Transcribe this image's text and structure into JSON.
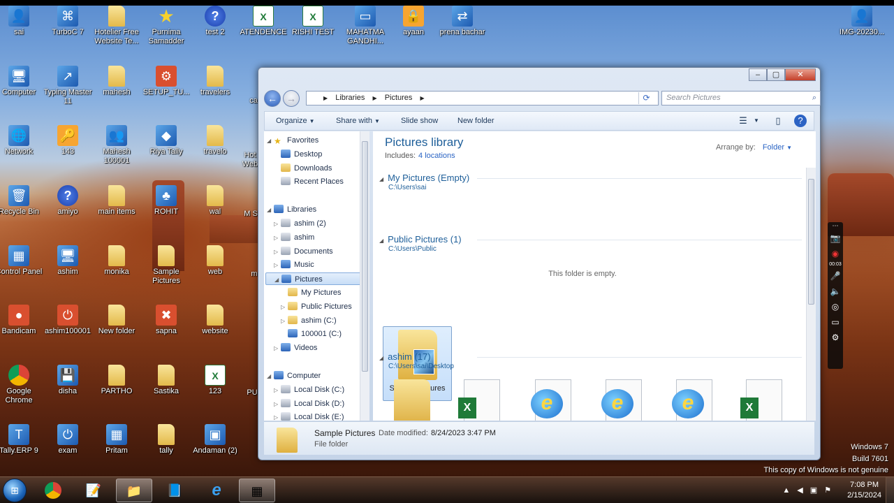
{
  "desktop_icons": [
    {
      "label": "sai",
      "icon": "user-folder-icon",
      "glyph": "👤",
      "kind": "app"
    },
    {
      "label": "TurboC 7",
      "icon": "turboc-icon",
      "glyph": "⌘",
      "kind": "app"
    },
    {
      "label": "Hotelier Free Website Te...",
      "icon": "folder-icon",
      "glyph": "",
      "kind": "folder"
    },
    {
      "label": "Purnima Samadder",
      "icon": "star-icon",
      "glyph": "★",
      "kind": "star"
    },
    {
      "label": "test 2",
      "icon": "help-icon",
      "glyph": "?",
      "kind": "help"
    },
    {
      "label": "ATENDENCE",
      "icon": "excel-icon",
      "glyph": "X",
      "kind": "excel"
    },
    {
      "label": "RISHI TEST",
      "icon": "excel-icon",
      "glyph": "X",
      "kind": "excel"
    },
    {
      "label": "MAHATMA GANDHI...",
      "icon": "drive-icon",
      "glyph": "▭",
      "kind": "app"
    },
    {
      "label": "ayaan",
      "icon": "lock-icon",
      "glyph": "🔒",
      "kind": "orange"
    },
    {
      "label": "prena bachar",
      "icon": "network-icon",
      "glyph": "⇄",
      "kind": "app"
    },
    {
      "label": "Computer",
      "icon": "computer-icon",
      "glyph": "🖥",
      "kind": "app"
    },
    {
      "label": "Typing Master 11",
      "icon": "typing-master-icon",
      "glyph": "↗",
      "kind": "app"
    },
    {
      "label": "mahesh",
      "icon": "folder-icon",
      "glyph": "",
      "kind": "folder"
    },
    {
      "label": "SETUP_TU...",
      "icon": "setup-icon",
      "glyph": "⚙",
      "kind": "red"
    },
    {
      "label": "travelers",
      "icon": "folder-icon",
      "glyph": "",
      "kind": "folder"
    },
    {
      "label": "Network",
      "icon": "network-globe-icon",
      "glyph": "🌐",
      "kind": "app"
    },
    {
      "label": "143",
      "icon": "key-icon",
      "glyph": "🔑",
      "kind": "orange"
    },
    {
      "label": "Mahesh 100001",
      "icon": "people-icon",
      "glyph": "👥",
      "kind": "app"
    },
    {
      "label": "Riya Tally",
      "icon": "tally-icon",
      "glyph": "◆",
      "kind": "app"
    },
    {
      "label": "travelo",
      "icon": "folder-icon",
      "glyph": "",
      "kind": "folder"
    },
    {
      "label": "Recycle Bin",
      "icon": "recycle-bin-icon",
      "glyph": "🗑",
      "kind": "app"
    },
    {
      "label": "amiyo",
      "icon": "help-icon",
      "glyph": "?",
      "kind": "help"
    },
    {
      "label": "main items",
      "icon": "folder-icon",
      "glyph": "",
      "kind": "folder"
    },
    {
      "label": "ROHIT",
      "icon": "tree-icon",
      "glyph": "♣",
      "kind": "app"
    },
    {
      "label": "wal",
      "icon": "folder-icon",
      "glyph": "",
      "kind": "folder"
    },
    {
      "label": "Control Panel",
      "icon": "control-panel-icon",
      "glyph": "▦",
      "kind": "app"
    },
    {
      "label": "ashim",
      "icon": "computer-icon",
      "glyph": "🖥",
      "kind": "app"
    },
    {
      "label": "monika",
      "icon": "folder-icon",
      "glyph": "",
      "kind": "folder"
    },
    {
      "label": "Sample Pictures",
      "icon": "folder-icon",
      "glyph": "",
      "kind": "folder"
    },
    {
      "label": "web",
      "icon": "folder-icon",
      "glyph": "",
      "kind": "folder"
    },
    {
      "label": "Bandicam",
      "icon": "bandicam-icon",
      "glyph": "●",
      "kind": "red"
    },
    {
      "label": "ashim100001",
      "icon": "power-icon",
      "glyph": "⏻",
      "kind": "red"
    },
    {
      "label": "New folder",
      "icon": "folder-icon",
      "glyph": "",
      "kind": "folder"
    },
    {
      "label": "sapna",
      "icon": "x-icon",
      "glyph": "✖",
      "kind": "red"
    },
    {
      "label": "website",
      "icon": "folder-icon",
      "glyph": "",
      "kind": "folder"
    },
    {
      "label": "Google Chrome",
      "icon": "chrome-icon",
      "glyph": "",
      "kind": "chrome"
    },
    {
      "label": "disha",
      "icon": "user-drive-icon",
      "glyph": "💾",
      "kind": "app"
    },
    {
      "label": "PARTHO",
      "icon": "folder-icon",
      "glyph": "",
      "kind": "folder"
    },
    {
      "label": "Sastika",
      "icon": "folder-icon",
      "glyph": "",
      "kind": "folder"
    },
    {
      "label": "123",
      "icon": "excel-icon",
      "glyph": "X",
      "kind": "excel"
    },
    {
      "label": "Tally.ERP 9",
      "icon": "tally-erp-icon",
      "glyph": "T",
      "kind": "app"
    },
    {
      "label": "exam",
      "icon": "exam-power-icon",
      "glyph": "⏻",
      "kind": "app"
    },
    {
      "label": "Pritam",
      "icon": "spreadsheet-icon",
      "glyph": "▦",
      "kind": "app"
    },
    {
      "label": "tally",
      "icon": "folder-icon",
      "glyph": "",
      "kind": "folder"
    },
    {
      "label": "Andaman (2)",
      "icon": "image-icon",
      "glyph": "▣",
      "kind": "app"
    }
  ],
  "partial_icons": [
    "ca",
    "Hot Web",
    "M S",
    "m",
    "PU"
  ],
  "top_right_icon": "IMG-20230...",
  "explorer": {
    "address": [
      "Libraries",
      "Pictures"
    ],
    "search_placeholder": "Search Pictures",
    "toolbar": {
      "organize": "Organize",
      "share_with": "Share with",
      "slide_show": "Slide show",
      "new_folder": "New folder"
    },
    "nav": [
      {
        "label": "Favorites",
        "indent": 0,
        "arrow": "◢",
        "icon": "star",
        "name": "favorites"
      },
      {
        "label": "Desktop",
        "indent": 1,
        "arrow": "",
        "icon": "blue",
        "name": "desktop"
      },
      {
        "label": "Downloads",
        "indent": 1,
        "arrow": "",
        "icon": "fold",
        "name": "downloads"
      },
      {
        "label": "Recent Places",
        "indent": 1,
        "arrow": "",
        "icon": "grey",
        "name": "recent-places"
      },
      {
        "label": "",
        "indent": 0,
        "arrow": "",
        "icon": "",
        "name": "spacer"
      },
      {
        "label": "Libraries",
        "indent": 0,
        "arrow": "◢",
        "icon": "blue",
        "name": "libraries"
      },
      {
        "label": "ashim (2)",
        "indent": 1,
        "arrow": "▷",
        "icon": "grey",
        "name": "ashim-2"
      },
      {
        "label": "ashim",
        "indent": 1,
        "arrow": "▷",
        "icon": "grey",
        "name": "ashim"
      },
      {
        "label": "Documents",
        "indent": 1,
        "arrow": "▷",
        "icon": "grey",
        "name": "documents"
      },
      {
        "label": "Music",
        "indent": 1,
        "arrow": "▷",
        "icon": "blue",
        "name": "music"
      },
      {
        "label": "Pictures",
        "indent": 1,
        "arrow": "◢",
        "icon": "blue",
        "name": "pictures",
        "selected": true
      },
      {
        "label": "My Pictures",
        "indent": 2,
        "arrow": "",
        "icon": "fold",
        "name": "my-pictures"
      },
      {
        "label": "Public Pictures",
        "indent": 2,
        "arrow": "▷",
        "icon": "fold",
        "name": "public-pictures"
      },
      {
        "label": "ashim (C:)",
        "indent": 2,
        "arrow": "▷",
        "icon": "fold",
        "name": "ashim-c"
      },
      {
        "label": "100001 (C:)",
        "indent": 2,
        "arrow": "",
        "icon": "blue",
        "name": "100001-c"
      },
      {
        "label": "Videos",
        "indent": 1,
        "arrow": "▷",
        "icon": "blue",
        "name": "videos"
      },
      {
        "label": "",
        "indent": 0,
        "arrow": "",
        "icon": "",
        "name": "spacer"
      },
      {
        "label": "Computer",
        "indent": 0,
        "arrow": "◢",
        "icon": "blue",
        "name": "computer"
      },
      {
        "label": "Local Disk (C:)",
        "indent": 1,
        "arrow": "▷",
        "icon": "grey",
        "name": "local-disk-c"
      },
      {
        "label": "Local Disk (D:)",
        "indent": 1,
        "arrow": "▷",
        "icon": "grey",
        "name": "local-disk-d"
      },
      {
        "label": "Local Disk (E:)",
        "indent": 1,
        "arrow": "▷",
        "icon": "grey",
        "name": "local-disk-e"
      }
    ],
    "library_title": "Pictures library",
    "includes_label": "Includes:",
    "includes_link": "4 locations",
    "arrange_label": "Arrange by:",
    "arrange_value": "Folder",
    "groups": [
      {
        "title": "My Pictures (Empty)",
        "path": "C:\\Users\\sai"
      },
      {
        "title": "Public Pictures (1)",
        "path": "C:\\Users\\Public"
      },
      {
        "title": "ashim (17)",
        "path": "C:\\Users\\sai\\Desktop"
      }
    ],
    "empty_text": "This folder is empty.",
    "tile_label": "Sample Pictures",
    "details": {
      "name": "Sample Pictures",
      "type": "File folder",
      "modified_label": "Date modified:",
      "modified_value": "8/24/2023 3:47 PM"
    }
  },
  "watermark": {
    "line1": "Windows 7",
    "line2": "Build 7601",
    "line3": "This copy of Windows is not genuine"
  },
  "recorder_time": "00:03",
  "taskbar": {
    "time": "7:08 PM",
    "date": "2/15/2024"
  }
}
